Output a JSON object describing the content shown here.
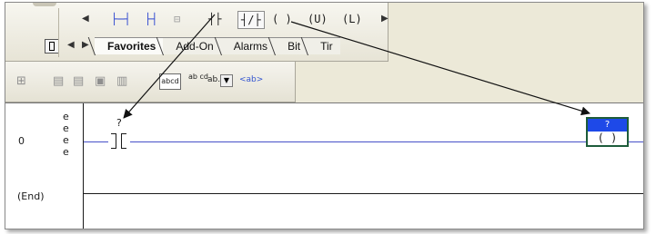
{
  "toolbar": {
    "instructions": {
      "rung": "├─┤",
      "branch": "├┤",
      "branch_level": "⊟",
      "xic": "┤├",
      "xio": "┤/├",
      "ote": "( )",
      "otu": "(U)",
      "otl": "(L)"
    },
    "tabs": [
      "Favorites",
      "Add-On",
      "Alarms",
      "Bit",
      "Tir"
    ],
    "active_tab": "Favorites"
  },
  "toolbar2": {
    "abc_label": "abcd",
    "ab_cd_label": "ab cd",
    "ab_dd_label": "ab...",
    "ab_tag_label": "<ab>"
  },
  "ladder": {
    "rungs": [
      {
        "number": "0",
        "edit_markers": [
          "e",
          "e",
          "e",
          "e"
        ],
        "xic_tag": "?",
        "ote_tag": "?",
        "ote_symbol": "( )"
      }
    ],
    "end_label": "(End)"
  },
  "colors": {
    "accent_blue": "#1e49e8",
    "rung_line": "#4650c8",
    "ote_border": "#1d5c3a"
  }
}
